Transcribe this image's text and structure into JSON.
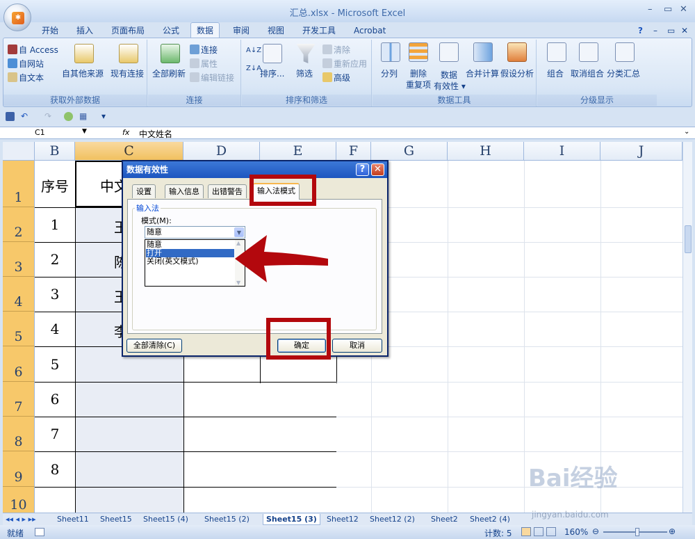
{
  "window": {
    "title": "汇总.xlsx - Microsoft Excel",
    "minimize": "–",
    "restore": "▭",
    "close": "✕"
  },
  "ribbon_tabs": [
    "开始",
    "插入",
    "页面布局",
    "公式",
    "数据",
    "审阅",
    "视图",
    "开发工具",
    "Acrobat"
  ],
  "groups": {
    "external": {
      "label": "获取外部数据",
      "access": "自 Access",
      "web": "自网站",
      "text": "自文本",
      "other": "自其他来源",
      "existing": "现有连接"
    },
    "connections": {
      "label": "连接",
      "refresh": "全部刷新",
      "conn": "连接",
      "props": "属性",
      "edit": "编辑链接"
    },
    "sort": {
      "label": "排序和筛选",
      "sort": "排序...",
      "filter": "筛选",
      "clear": "清除",
      "reapply": "重新应用",
      "advanced": "高级"
    },
    "tools": {
      "label": "数据工具",
      "split": "分列",
      "dedup1": "删除",
      "dedup2": "重复项",
      "valid1": "数据",
      "valid2": "有效性 ▾",
      "consolidate": "合并计算",
      "whatif": "假设分析"
    },
    "outline": {
      "label": "分级显示",
      "group": "组合",
      "ungroup": "取消组合",
      "subtotal": "分类汇总"
    }
  },
  "formula": {
    "cell_ref": "C1",
    "fx": "fx",
    "value": "中文姓名"
  },
  "columns": [
    "B",
    "C",
    "D",
    "E",
    "F",
    "G",
    "H",
    "I",
    "J"
  ],
  "rows": [
    "1",
    "2",
    "3",
    "4",
    "5",
    "6",
    "7",
    "8",
    "9",
    "10"
  ],
  "cells": {
    "b": [
      "序号",
      "1",
      "2",
      "3",
      "4",
      "5",
      "6",
      "7",
      "8"
    ],
    "c": [
      "中文",
      "王",
      "陈",
      "王",
      "李"
    ]
  },
  "sheet_tabs": [
    "Sheet11",
    "Sheet15",
    "Sheet15 (4)",
    "Sheet15 (2)",
    "Sheet15 (3)",
    "Sheet12",
    "Sheet12 (2)",
    "Sheet2",
    "Sheet2 (4)"
  ],
  "status": {
    "ready": "就绪",
    "count": "计数: 5",
    "zoom": "160%"
  },
  "dialog": {
    "title": "数据有效性",
    "help": "?",
    "close": "✕",
    "tabs": [
      "设置",
      "输入信息",
      "出错警告",
      "输入法模式"
    ],
    "legend": "输入法",
    "mode_label": "模式(M):",
    "combo_value": "随意",
    "options": [
      "随意",
      "打开",
      "关闭(英文模式)"
    ],
    "selected_option": "打开",
    "clear_all": "全部清除(C)",
    "ok": "确定",
    "cancel": "取消"
  },
  "watermark": {
    "main": "Bai经验",
    "url": "jingyan.baidu.com"
  },
  "colors": {
    "highlight": "#b3080d",
    "selection": "#316ac5",
    "row_header_selected": "#f7c86a"
  }
}
